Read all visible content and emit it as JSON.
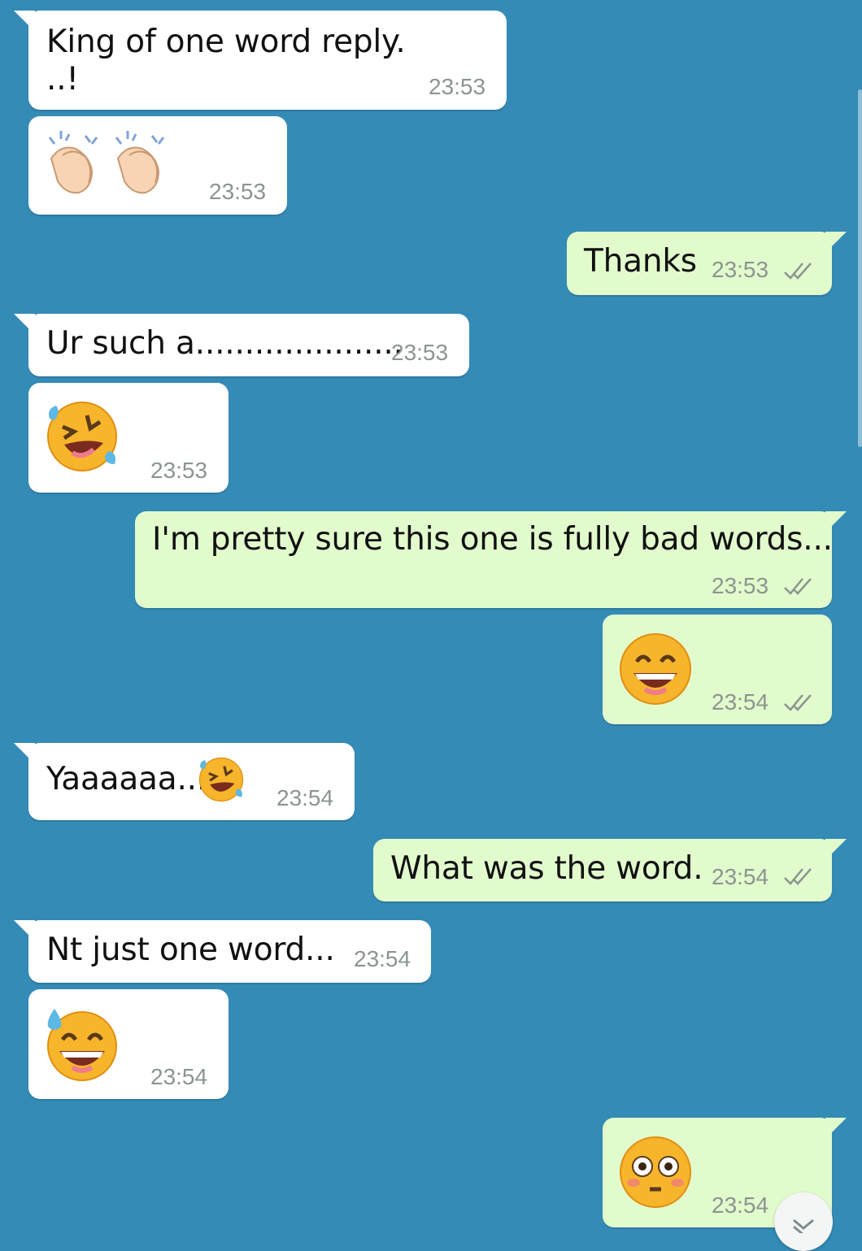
{
  "theme": {
    "chat_background": "#348bb6",
    "incoming_bubble": "#ffffff",
    "outgoing_bubble": "#e2fbcd",
    "tick_color": "#8b9590"
  },
  "messages": [
    {
      "direction": "incoming",
      "line1": "King of one word reply.",
      "line2": "..!",
      "time": "23:53"
    },
    {
      "direction": "incoming",
      "emoji": "clapping-hands-icon",
      "time": "23:53"
    },
    {
      "direction": "outgoing",
      "text": "Thanks",
      "time": "23:53",
      "status": "delivered"
    },
    {
      "direction": "incoming",
      "text": "Ur such a.....................",
      "time": "23:53"
    },
    {
      "direction": "incoming",
      "emoji": "rolling-laughing-icon",
      "time": "23:53"
    },
    {
      "direction": "outgoing",
      "text": "I'm pretty sure this one is fully bad words...",
      "time": "23:53",
      "status": "delivered"
    },
    {
      "direction": "outgoing",
      "emoji": "grinning-face-icon",
      "time": "23:54",
      "status": "delivered"
    },
    {
      "direction": "incoming",
      "text": "Yaaaaaa...",
      "emoji": "rolling-laughing-icon",
      "time": "23:54"
    },
    {
      "direction": "outgoing",
      "text": "What was the word.",
      "time": "23:54",
      "status": "delivered"
    },
    {
      "direction": "incoming",
      "text": "Nt just one word...",
      "time": "23:54"
    },
    {
      "direction": "incoming",
      "emoji": "sweat-smile-icon",
      "time": "23:54"
    },
    {
      "direction": "outgoing",
      "emoji": "flushed-face-icon",
      "time": "23:54",
      "status": "delivered"
    }
  ],
  "scroll_button": {
    "icon": "chevron-down-icon"
  }
}
